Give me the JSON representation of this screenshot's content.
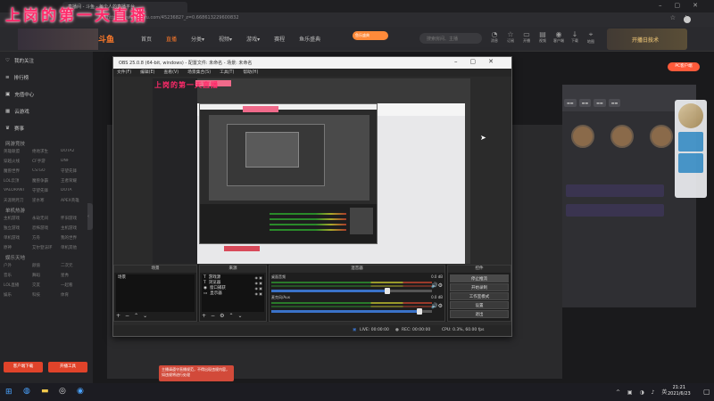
{
  "overlay": {
    "title": "上岗的第一天直播"
  },
  "browser": {
    "tab_title": "直播间 - 斗鱼 - 每个人的直播平台",
    "url": "https://www.douyu.com/4523682?_z=0.668613229600832"
  },
  "site": {
    "logo": "斗鱼",
    "nav": [
      "首页",
      "直播",
      "分类▾",
      "视频▾",
      "游戏▾",
      "赛程",
      "鱼乐盛典"
    ],
    "active_nav": "直播",
    "search_placeholder": "搜索房间、主播",
    "promo_label": "鱼乐盛典",
    "actions": [
      {
        "icon": "bell-icon",
        "label": "消息"
      },
      {
        "icon": "star-icon",
        "label": "订阅"
      },
      {
        "icon": "play-icon",
        "label": "开播"
      },
      {
        "icon": "video-icon",
        "label": "视频"
      },
      {
        "icon": "user-icon",
        "label": "客户端"
      },
      {
        "icon": "download-icon",
        "label": "下载"
      },
      {
        "icon": "pin-icon",
        "label": "地图"
      }
    ],
    "banner_right": "开播日技术",
    "pc_badge": "PC客户端"
  },
  "sidebar": {
    "main": [
      {
        "icon": "heart-icon",
        "label": "我的关注"
      },
      {
        "icon": "list-icon",
        "label": "排行榜"
      },
      {
        "icon": "gift-icon",
        "label": "充值中心"
      },
      {
        "icon": "grid-icon",
        "label": "云游戏"
      },
      {
        "icon": "trophy-icon",
        "label": "赛事"
      }
    ],
    "sections": [
      {
        "title": "网游竞技",
        "items": [
          "英雄联盟",
          "绝地求生",
          "DOTA2",
          "穿越火线",
          "CF手游",
          "DNF",
          "魔兽世界",
          "CS:GO",
          "守望先锋",
          "LOL云顶",
          "魔兽争霸",
          "王者荣耀",
          "VALORANT",
          "守望先锋",
          "DOTA",
          "天涯明月刀",
          "逆水寒",
          "APEX英雄"
        ]
      },
      {
        "title": "单机热游",
        "items": [
          "主机游戏",
          "永劫无间",
          "怀旧游戏",
          "独立游戏",
          "恐怖游戏",
          "主机游戏",
          "单机游戏",
          "方舟",
          "我的世界",
          "原神",
          "艾尔登法环",
          "单机其他"
        ]
      },
      {
        "title": "娱乐天地",
        "items": [
          "户外",
          "颜值",
          "二次元",
          "音乐",
          "舞蹈",
          "星秀",
          "LOL直播",
          "交友",
          "一起看",
          "娱乐",
          "科技",
          "体育"
        ]
      }
    ],
    "bottom_buttons": [
      "客户端下载",
      "开播工具"
    ]
  },
  "obs": {
    "title": "OBS 25.0.8 (64-bit, windows) - 配置文件: 未命名 - 场景: 未命名",
    "menu": [
      "文件(F)",
      "编辑(E)",
      "查看(V)",
      "场景集合(S)",
      "工具(T)",
      "帮助(H)"
    ],
    "docks": {
      "scenes": {
        "title": "场景",
        "items": [
          "场景"
        ]
      },
      "sources": {
        "title": "来源",
        "items": [
          "游戏源",
          "浏览器",
          "窗口捕获",
          "显示器"
        ]
      },
      "mixer": {
        "title": "混音器",
        "tracks": [
          {
            "name": "桌面音频",
            "db": "0.0 dB",
            "level": 0.72
          },
          {
            "name": "麦克风/Aux",
            "db": "0.0 dB",
            "level": 0.92
          }
        ]
      },
      "controls": {
        "title": "控件",
        "buttons": [
          "停止推流",
          "开始录制",
          "工作室模式",
          "设置",
          "退出"
        ]
      }
    },
    "status": {
      "live": "LIVE: 00:00:00",
      "rec": "REC: 00:00:00",
      "cpu": "CPU: 0.3%, 60.00 fps"
    }
  },
  "toast": "主播请遵守直播规范，不得出现违规内容，如违规将进行处理",
  "taskbar": {
    "time": "21:21",
    "date": "2021/6/23"
  }
}
